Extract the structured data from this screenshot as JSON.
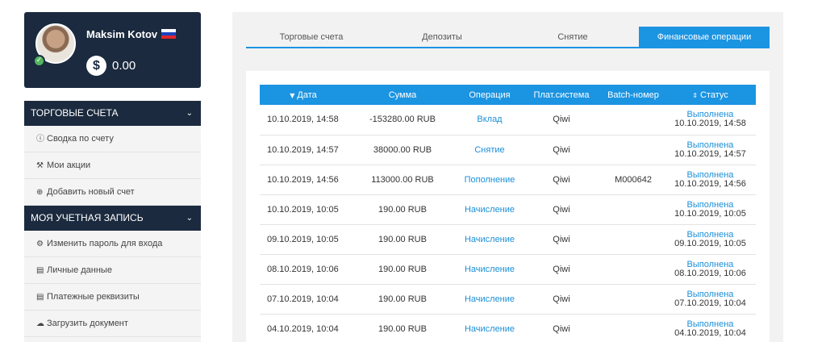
{
  "profile": {
    "name": "Maksim Kotov",
    "balance": "0.00",
    "coin_symbol": "$"
  },
  "menu": {
    "sections": [
      {
        "title": "ТОРГОВЫЕ СЧЕТА",
        "items": [
          {
            "icon": "info-icon",
            "label": "Сводка по счету"
          },
          {
            "icon": "gavel-icon",
            "label": "Мои акции"
          },
          {
            "icon": "plus-circle-icon",
            "label": "Добавить новый счет"
          }
        ]
      },
      {
        "title": "МОЯ УЧЕТНАЯ ЗАПИСЬ",
        "items": [
          {
            "icon": "gears-icon",
            "label": "Изменить пароль для входа"
          },
          {
            "icon": "id-card-icon",
            "label": "Личные данные"
          },
          {
            "icon": "id-card-icon",
            "label": "Платежные реквизиты"
          },
          {
            "icon": "cloud-upload-icon",
            "label": "Загрузить документ"
          }
        ]
      }
    ]
  },
  "tabs": [
    {
      "label": "Торговые счета",
      "active": false
    },
    {
      "label": "Депозиты",
      "active": false
    },
    {
      "label": "Снятие",
      "active": false
    },
    {
      "label": "Финансовые операции",
      "active": true
    }
  ],
  "table": {
    "headers": [
      "Дата",
      "Сумма",
      "Операция",
      "Плат.система",
      "Batch-номер",
      "Статус"
    ],
    "rows": [
      {
        "date": "10.10.2019, 14:58",
        "amount": "-153280.00 RUB",
        "operation": "Вклад",
        "system": "Qiwi",
        "batch": "",
        "status": "Выполнена",
        "status_date": "10.10.2019, 14:58"
      },
      {
        "date": "10.10.2019, 14:57",
        "amount": "38000.00 RUB",
        "operation": "Снятие",
        "system": "Qiwi",
        "batch": "",
        "status": "Выполнена",
        "status_date": "10.10.2019, 14:57"
      },
      {
        "date": "10.10.2019, 14:56",
        "amount": "113000.00 RUB",
        "operation": "Пополнение",
        "system": "Qiwi",
        "batch": "M000642",
        "status": "Выполнена",
        "status_date": "10.10.2019, 14:56"
      },
      {
        "date": "10.10.2019, 10:05",
        "amount": "190.00 RUB",
        "operation": "Начисление",
        "system": "Qiwi",
        "batch": "",
        "status": "Выполнена",
        "status_date": "10.10.2019, 10:05"
      },
      {
        "date": "09.10.2019, 10:05",
        "amount": "190.00 RUB",
        "operation": "Начисление",
        "system": "Qiwi",
        "batch": "",
        "status": "Выполнена",
        "status_date": "09.10.2019, 10:05"
      },
      {
        "date": "08.10.2019, 10:06",
        "amount": "190.00 RUB",
        "operation": "Начисление",
        "system": "Qiwi",
        "batch": "",
        "status": "Выполнена",
        "status_date": "08.10.2019, 10:06"
      },
      {
        "date": "07.10.2019, 10:04",
        "amount": "190.00 RUB",
        "operation": "Начисление",
        "system": "Qiwi",
        "batch": "",
        "status": "Выполнена",
        "status_date": "07.10.2019, 10:04"
      },
      {
        "date": "04.10.2019, 10:04",
        "amount": "190.00 RUB",
        "operation": "Начисление",
        "system": "Qiwi",
        "batch": "",
        "status": "Выполнена",
        "status_date": "04.10.2019, 10:04"
      }
    ]
  },
  "colors": {
    "accent": "#1b94e2",
    "sidebar_dark": "#1b2a3e",
    "link": "#1b8fd8"
  }
}
